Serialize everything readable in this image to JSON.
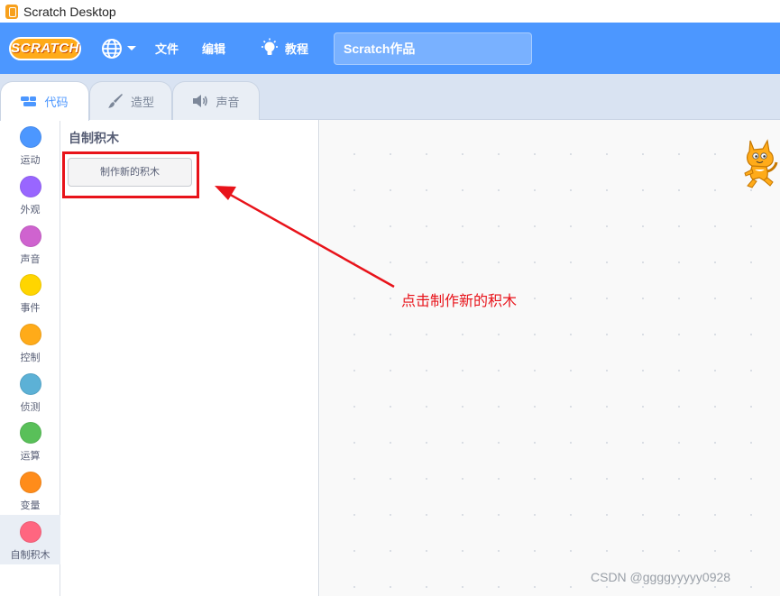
{
  "window": {
    "title": "Scratch Desktop"
  },
  "menubar": {
    "logo_text": "SCRATCH",
    "language_icon": "globe-icon",
    "file_label": "文件",
    "edit_label": "编辑",
    "tutorials_label": "教程",
    "tutorials_icon": "lightbulb-icon",
    "project_title": "Scratch作品",
    "background_color": "#4c97ff"
  },
  "tabs": [
    {
      "label": "代码",
      "icon": "code-icon",
      "active": true
    },
    {
      "label": "造型",
      "icon": "brush-icon",
      "active": false
    },
    {
      "label": "声音",
      "icon": "speaker-icon",
      "active": false
    }
  ],
  "categories": [
    {
      "label": "运动",
      "color": "#4c97ff"
    },
    {
      "label": "外观",
      "color": "#9966ff"
    },
    {
      "label": "声音",
      "color": "#cf63cf"
    },
    {
      "label": "事件",
      "color": "#ffd500"
    },
    {
      "label": "控制",
      "color": "#ffab19"
    },
    {
      "label": "侦测",
      "color": "#5cb1d6"
    },
    {
      "label": "运算",
      "color": "#59c059"
    },
    {
      "label": "变量",
      "color": "#ff8c1a"
    },
    {
      "label": "自制积木",
      "color": "#ff6680",
      "selected": true
    }
  ],
  "palette": {
    "heading": "自制积木",
    "make_block_label": "制作新的积木"
  },
  "annotation": {
    "text": "点击制作新的积木",
    "color": "#e8131a"
  },
  "watermark": "CSDN @ggggyyyyy0928"
}
